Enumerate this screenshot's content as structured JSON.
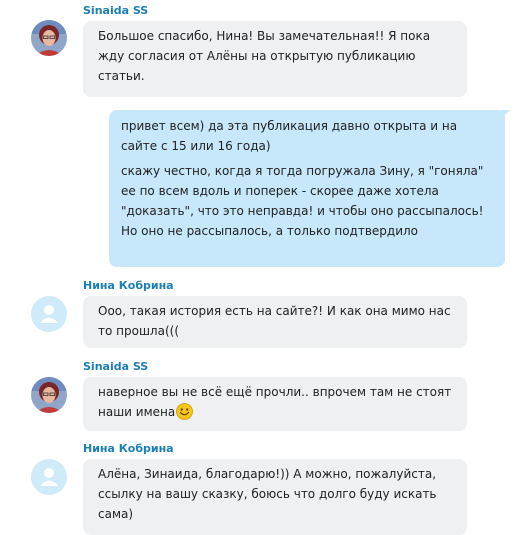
{
  "messages": [
    {
      "sender": "Sinaida SS",
      "avatar": "user-photo-avatar",
      "text": "Большое спасибо, Нина! Вы замечательная!! Я пока жду согласия от Алёны на открытую публикацию статьи."
    },
    {
      "outgoing": true,
      "paragraphs": [
        "привет всем) да эта публикация давно открыта и на сайте с 15 или 16 года)",
        "скажу честно, когда я тогда погружала Зину, я \"гоняла\" ее по всем вдоль и поперек - скорее даже хотела \"доказать\", что это неправда! и чтобы оно рассыпалось! Но оно не рассыпалось, а только подтвердило"
      ]
    },
    {
      "sender": "Нина Кобрина",
      "avatar": "default-user-avatar",
      "text": "Ооо, такая история есть на сайте?! И как она мимо нас то прошла((("
    },
    {
      "sender": "Sinaida SS",
      "avatar": "user-photo-avatar",
      "text": "наверное вы не всё ещё прочли.. впрочем там не стоят наши имена",
      "emoji": "smile-emoji-icon"
    },
    {
      "sender": "Нина Кобрина",
      "avatar": "default-user-avatar",
      "text": "Алёна, Зинаида, благодарю!)) А можно, пожалуйста, ссылку на вашу сказку, боюсь что долго буду искать сама)"
    }
  ],
  "colors": {
    "sender_name": "#1a7fb5",
    "incoming_bubble": "#eef0f2",
    "outgoing_bubble": "#c7e7fb",
    "default_avatar_bg": "#cfeaf8"
  }
}
